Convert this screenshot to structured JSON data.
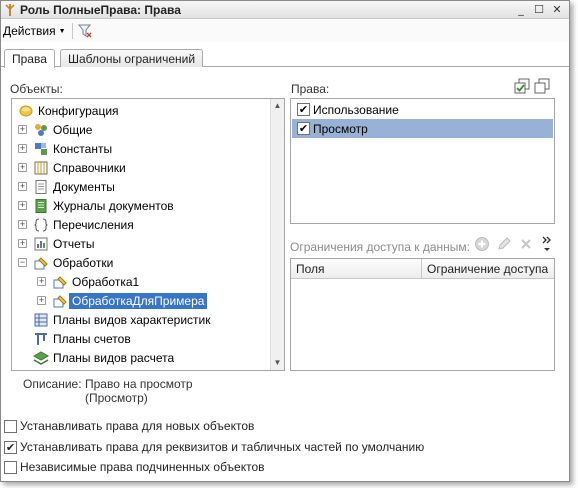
{
  "window": {
    "title": "Роль ПолныеПрава: Права",
    "minimize": "_",
    "maximize": "☐",
    "close": "✕"
  },
  "toolbar": {
    "actions_label": "Действия"
  },
  "tabs": [
    {
      "label": "Права"
    },
    {
      "label": "Шаблоны ограничений"
    }
  ],
  "objects": {
    "label": "Объекты:",
    "tree": [
      {
        "label": "Конфигурация",
        "icon": "configuration-icon",
        "level": 0
      },
      {
        "label": "Общие",
        "icon": "common-icon",
        "level": 1
      },
      {
        "label": "Константы",
        "icon": "constants-icon",
        "level": 1
      },
      {
        "label": "Справочники",
        "icon": "catalogs-icon",
        "level": 1
      },
      {
        "label": "Документы",
        "icon": "documents-icon",
        "level": 1
      },
      {
        "label": "Журналы документов",
        "icon": "journals-icon",
        "level": 1
      },
      {
        "label": "Перечисления",
        "icon": "enums-icon",
        "level": 1
      },
      {
        "label": "Отчеты",
        "icon": "reports-icon",
        "level": 1
      },
      {
        "label": "Обработки",
        "icon": "dataprocessors-icon",
        "level": 1,
        "expanded": true
      },
      {
        "label": "Обработка1",
        "icon": "dataprocessor-icon",
        "level": 2
      },
      {
        "label": "ОбработкаДляПримера",
        "icon": "dataprocessor-icon",
        "level": 2,
        "selected": true
      },
      {
        "label": "Планы видов характеристик",
        "icon": "chart-char-types-icon",
        "level": 1
      },
      {
        "label": "Планы счетов",
        "icon": "chart-accounts-icon",
        "level": 1
      },
      {
        "label": "Планы видов расчета",
        "icon": "chart-calc-types-icon",
        "level": 1
      }
    ]
  },
  "rights": {
    "label": "Права:",
    "items": [
      {
        "label": "Использование",
        "checked": true,
        "selected": false
      },
      {
        "label": "Просмотр",
        "checked": true,
        "selected": true
      }
    ]
  },
  "restrictions": {
    "label": "Ограничения доступа к данным:",
    "columns": [
      "Поля",
      "Ограничение доступа"
    ]
  },
  "description": {
    "label": "Описание:",
    "line1": "Право на просмотр",
    "line2": "(Просмотр)"
  },
  "options": [
    {
      "label": "Устанавливать права для новых объектов",
      "checked": false
    },
    {
      "label": "Устанавливать права для реквизитов и табличных частей по умолчанию",
      "checked": true
    },
    {
      "label": "Независимые права подчиненных объектов",
      "checked": false
    }
  ],
  "colors": {
    "selection": "#3874c8",
    "row_selection": "#98b1d6"
  }
}
